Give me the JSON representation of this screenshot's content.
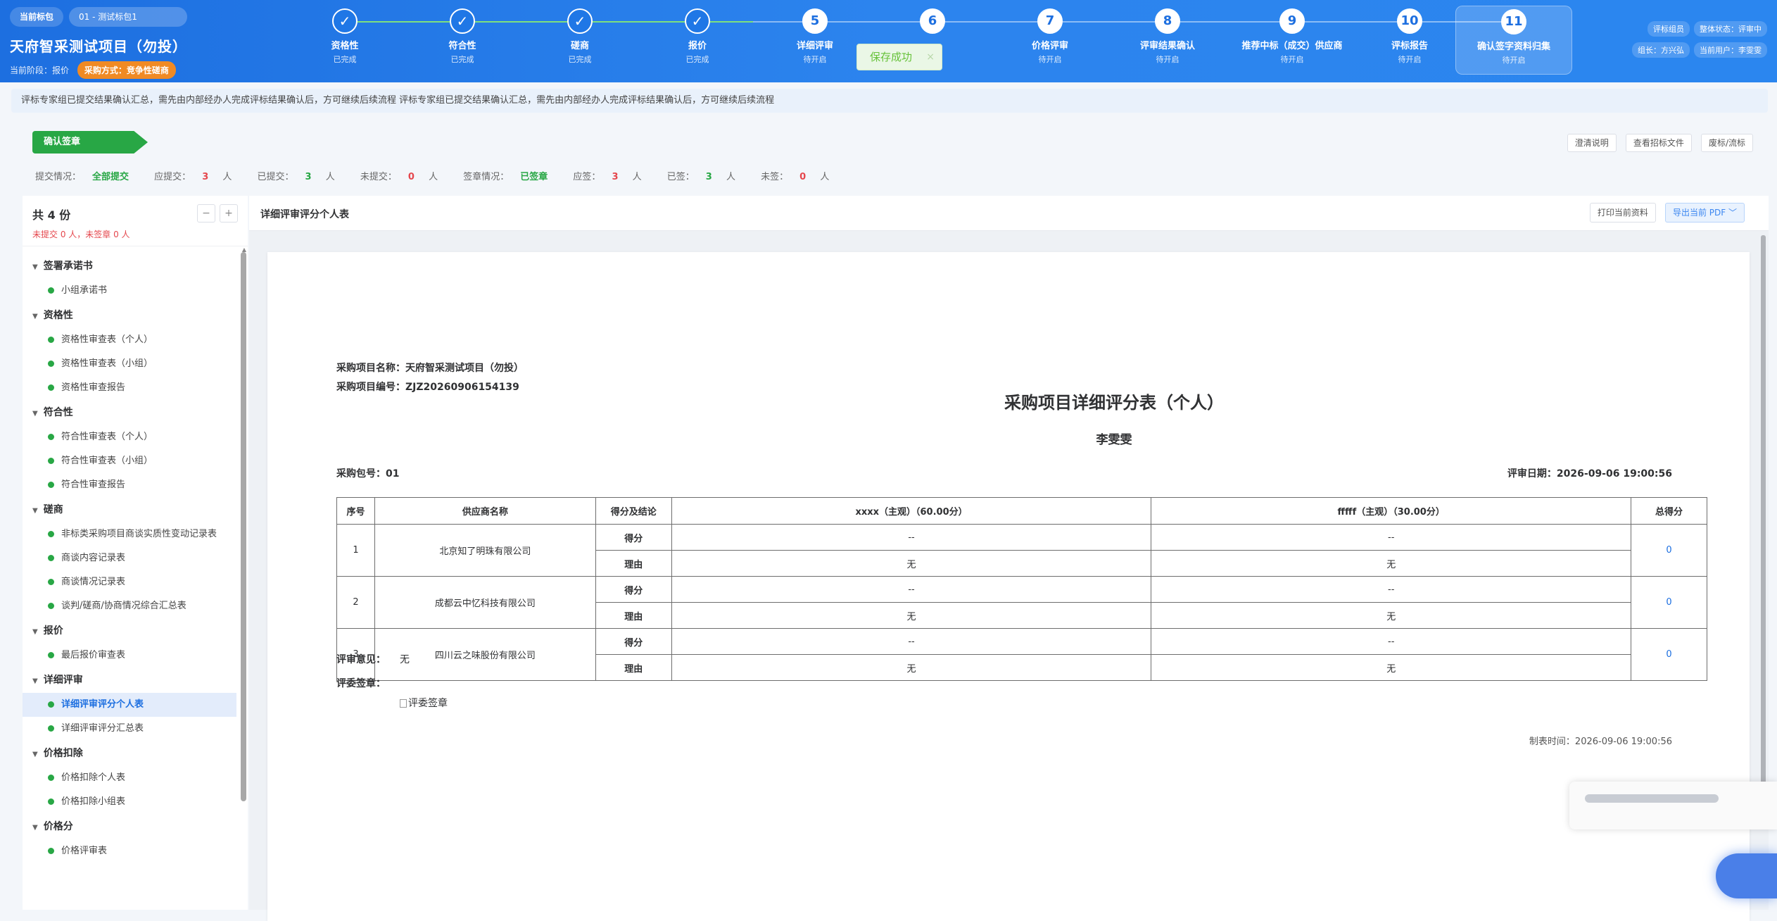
{
  "header": {
    "current_package_label": "当前标包",
    "package_name": "01 - 测试标包1",
    "project_title": "天府智采测试项目（勿投）",
    "stage_label": "当前阶段：报价",
    "method_label": "采购方式：竞争性磋商",
    "steps": [
      {
        "num": "✓",
        "label": "资格性",
        "status": "已完成",
        "done": true
      },
      {
        "num": "✓",
        "label": "符合性",
        "status": "已完成",
        "done": true
      },
      {
        "num": "✓",
        "label": "磋商",
        "status": "已完成",
        "done": true
      },
      {
        "num": "✓",
        "label": "报价",
        "status": "已完成",
        "done": true
      },
      {
        "num": "5",
        "label": "详细评审",
        "status": "待开启",
        "done": false
      },
      {
        "num": "6",
        "label": "",
        "status": "",
        "done": false
      },
      {
        "num": "7",
        "label": "价格评审",
        "status": "待开启",
        "done": false
      },
      {
        "num": "8",
        "label": "评审结果确认",
        "status": "待开启",
        "done": false
      },
      {
        "num": "9",
        "label": "推荐中标（成交）供应商",
        "status": "待开启",
        "done": false
      },
      {
        "num": "10",
        "label": "评标报告",
        "status": "待开启",
        "done": false
      },
      {
        "num": "11",
        "label": "确认签字资料归集",
        "status": "待开启",
        "done": false,
        "active": true
      }
    ],
    "toast": {
      "text": "保存成功",
      "close": "×"
    },
    "role_tag": "评标组员",
    "overall_status": "整体状态：评审中",
    "leader": "组长：方兴弘",
    "current_user": "当前用户：李雯雯"
  },
  "notice": "评标专家组已提交结果确认汇总，需先由内部经办人完成评标结果确认后，方可继续后续流程 评标专家组已提交结果确认汇总，需先由内部经办人完成评标结果确认后，方可继续后续流程",
  "confirm_tag": "确认签章",
  "top_buttons": [
    "澄清说明",
    "查看招标文件",
    "废标/流标"
  ],
  "stats": {
    "submit_label": "提交情况：",
    "submit_value": "全部提交",
    "should_submit_label": "应提交：",
    "should_submit": "3",
    "submitted_label": "已提交：",
    "submitted": "3",
    "not_submitted_label": "未提交：",
    "not_submitted": "0",
    "sign_label": "签章情况：",
    "sign_value": "已签章",
    "should_sign_label": "应签：",
    "should_sign": "3",
    "signed_label": "已签：",
    "signed": "3",
    "not_signed_label": "未签：",
    "not_signed": "0",
    "unit": "人"
  },
  "sidebar": {
    "total": "共 4 份",
    "sub": "未提交 0 人，未签章 0 人",
    "minus": "−",
    "plus": "+",
    "groups": [
      {
        "title": "签署承诺书",
        "items": [
          "小组承诺书"
        ]
      },
      {
        "title": "资格性",
        "items": [
          "资格性审查表（个人）",
          "资格性审查表（小组）",
          "资格性审查报告"
        ]
      },
      {
        "title": "符合性",
        "items": [
          "符合性审查表（个人）",
          "符合性审查表（小组）",
          "符合性审查报告"
        ]
      },
      {
        "title": "磋商",
        "items": [
          "非标类采购项目商谈实质性变动记录表",
          "商谈内容记录表",
          "商谈情况记录表",
          "谈判/磋商/协商情况综合汇总表"
        ]
      },
      {
        "title": "报价",
        "items": [
          "最后报价审查表"
        ]
      },
      {
        "title": "详细评审",
        "items": [
          "详细评审评分个人表",
          "详细评审评分汇总表"
        ]
      },
      {
        "title": "价格扣除",
        "items": [
          "价格扣除个人表",
          "价格扣除小组表"
        ]
      },
      {
        "title": "价格分",
        "items": [
          "价格评审表"
        ]
      }
    ],
    "selected": "详细评审评分个人表"
  },
  "main": {
    "title": "详细评审评分个人表",
    "print_btn": "打印当前资料",
    "export_btn": "导出当前 PDF ﹀"
  },
  "document": {
    "project_name_label": "采购项目名称：",
    "project_name": "天府智采测试项目（勿投）",
    "project_no_label": "采购项目编号：",
    "project_no": "ZJZ20260906154139",
    "title": "采购项目详细评分表（个人）",
    "person": "李雯雯",
    "package_no": "采购包号：01",
    "eval_date": "评审日期：2026-09-06 19:00:56",
    "headers": [
      "序号",
      "供应商名称",
      "得分及结论",
      "xxxx（主观）（60.00分）",
      "fffff（主观）（30.00分）",
      "总得分"
    ],
    "rows": [
      {
        "no": "1",
        "supplier": "北京知了明珠有限公司",
        "score_label": "得分",
        "reason_label": "理由",
        "c1_score": "--",
        "c2_score": "--",
        "c1_reason": "无",
        "c2_reason": "无",
        "total": "0"
      },
      {
        "no": "2",
        "supplier": "成都云中忆科技有限公司",
        "score_label": "得分",
        "reason_label": "理由",
        "c1_score": "--",
        "c2_score": "--",
        "c1_reason": "无",
        "c2_reason": "无",
        "total": "0"
      },
      {
        "no": "3",
        "supplier": "四川云之味股份有限公司",
        "score_label": "得分",
        "reason_label": "理由",
        "c1_score": "--",
        "c2_score": "--",
        "c1_reason": "无",
        "c2_reason": "无",
        "total": "0"
      }
    ],
    "opinion_label": "评审意见：",
    "opinion": "无",
    "sign_label": "评委签章：",
    "sign_img_alt": "评委签章",
    "made_time": "制表时间：2026-09-06 19:00:56"
  }
}
